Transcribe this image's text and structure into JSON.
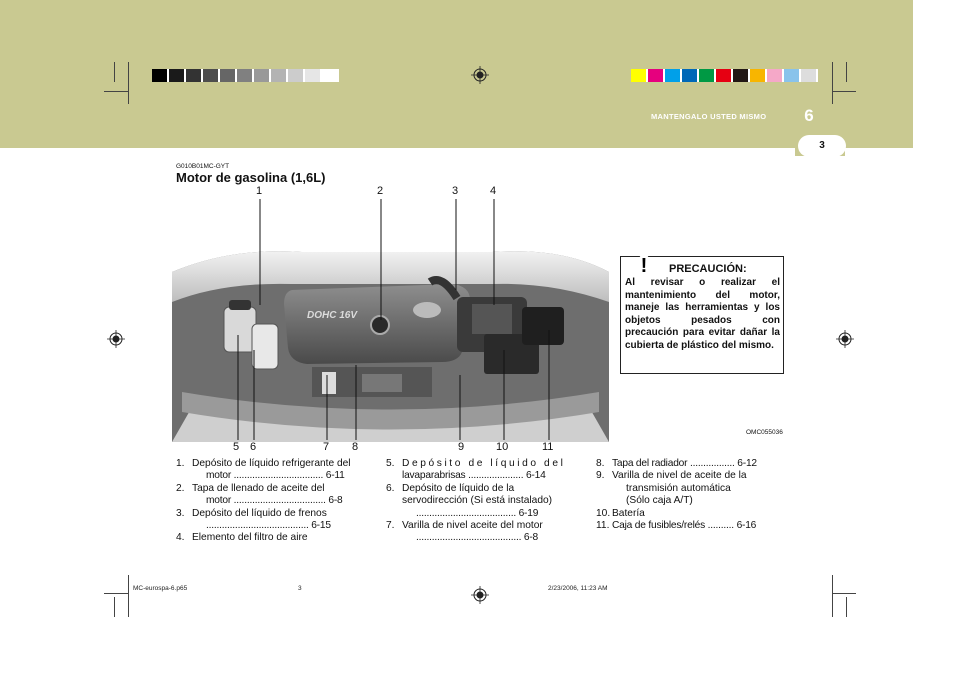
{
  "header": {
    "section_label": "MANTENGALO USTED MISMO",
    "section_number": "6",
    "page_number": "3",
    "band_color": "#c9c991"
  },
  "color_bar_left": [
    "#000000",
    "#1a1a1a",
    "#333333",
    "#4d4d4d",
    "#666666",
    "#808080",
    "#999999",
    "#b3b3b3",
    "#cccccc",
    "#e6e6e6",
    "#ffffff"
  ],
  "color_bar_right": [
    "#ffff00",
    "#e6007e",
    "#00a0e9",
    "#0068b7",
    "#009944",
    "#e60012",
    "#231815",
    "#f8b500",
    "#f5a8c8",
    "#89c3eb",
    "#dddddd"
  ],
  "content": {
    "code": "G010B01MC-GYT",
    "title": "Motor de gasolina (1,6L)",
    "callouts_top": [
      "1",
      "2",
      "3",
      "4"
    ],
    "callouts_bottom": [
      "5",
      "6",
      "7",
      "8",
      "9",
      "10",
      "11"
    ],
    "image_ref": "OMC055036"
  },
  "warning": {
    "title": "PRECAUCIÓN:",
    "icon": "exclamation-triangle-icon",
    "body": "Al revisar o realizar el mantenimiento del motor, maneje las herramientas y los objetos pesados con precaución para evitar dañar la cubierta de plástico del mismo."
  },
  "list_col1": [
    {
      "n": "1.",
      "text": "Depósito de líquido refrigerante del",
      "cont": "motor .................................. 6-11"
    },
    {
      "n": "2.",
      "text": "Tapa de llenado de aceite del",
      "cont": "motor ................................... 6-8"
    },
    {
      "n": "3.",
      "text": "Depósito del líquido de frenos",
      "cont": "....................................... 6-15"
    },
    {
      "n": "4.",
      "text": "Elemento del filtro de aire",
      "cont": ""
    }
  ],
  "list_col2": [
    {
      "n": "5.",
      "text": "Depósito de líquido del",
      "cont": "lavaparabrisas ..................... 6-14"
    },
    {
      "n": "6.",
      "text": "Depósito de líquido de la",
      "cont": "servodirección (Si está instalado)"
    },
    {
      "n": "",
      "text": "",
      "cont": "...................................... 6-19"
    },
    {
      "n": "7.",
      "text": "Varilla de nivel aceite del motor",
      "cont": "........................................ 6-8"
    }
  ],
  "list_col3": [
    {
      "n": "8.",
      "text": "Tapa del radiador ................. 6-12",
      "cont": ""
    },
    {
      "n": "9.",
      "text": "Varilla de nivel de aceite de la",
      "cont": "transmisión automática"
    },
    {
      "n": "",
      "text": "",
      "cont": "(Sólo caja A/T)"
    },
    {
      "n": "10.",
      "text": "Batería",
      "cont": ""
    },
    {
      "n": "11.",
      "text": "Caja de fusibles/relés .......... 6-16",
      "cont": ""
    }
  ],
  "footer": {
    "file": "MC-eurospa-6.p65",
    "page": "3",
    "date": "2/23/2006, 11:23 AM"
  }
}
